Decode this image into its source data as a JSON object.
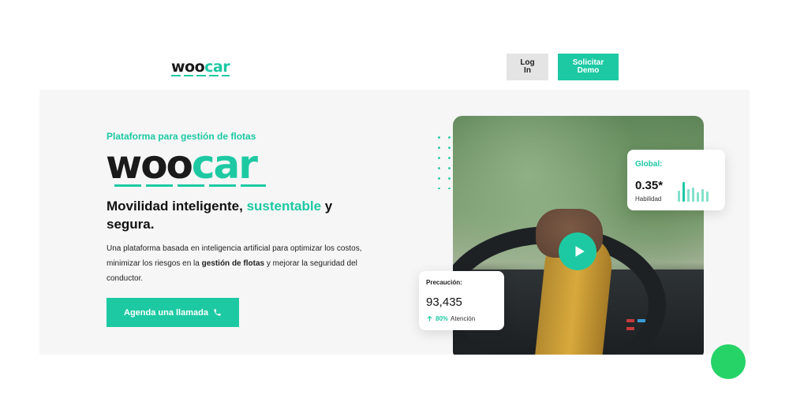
{
  "header": {
    "logo_dark": "woo",
    "logo_accent": "car",
    "login_label": "Log In",
    "demo_label": "Solicitar Demo"
  },
  "hero": {
    "tagline": "Plataforma para gestión de flotas",
    "logo_dark": "woo",
    "logo_accent": "car",
    "headline_part1": "Movilidad inteligente, ",
    "headline_accent": "sustentable",
    "headline_part2": " y segura.",
    "desc_part1": "Una plataforma basada en inteligencia artificial para optimizar los costos, minimizar los riesgos en la ",
    "desc_bold": "gestión de flotas",
    "desc_part2": " y mejorar la seguridad del conductor.",
    "cta_label": "Agenda una llamada",
    "cta_icon": "phone-icon"
  },
  "cards": {
    "global": {
      "label": "Global:",
      "value": "0.35*",
      "sublabel": "Habilidad",
      "bars": [
        0.55,
        0.95,
        0.6,
        0.7,
        0.45,
        0.6,
        0.5
      ]
    },
    "precaucion": {
      "label": "Precaución:",
      "value": "93,435",
      "percent": "80%",
      "percent_label": "Atención",
      "trend_icon": "arrow-up-icon"
    }
  },
  "colors": {
    "accent": "#1dc9a3",
    "hero_bg": "#f6f6f6",
    "login_bg": "#e4e4e4",
    "whatsapp": "#25d366"
  }
}
